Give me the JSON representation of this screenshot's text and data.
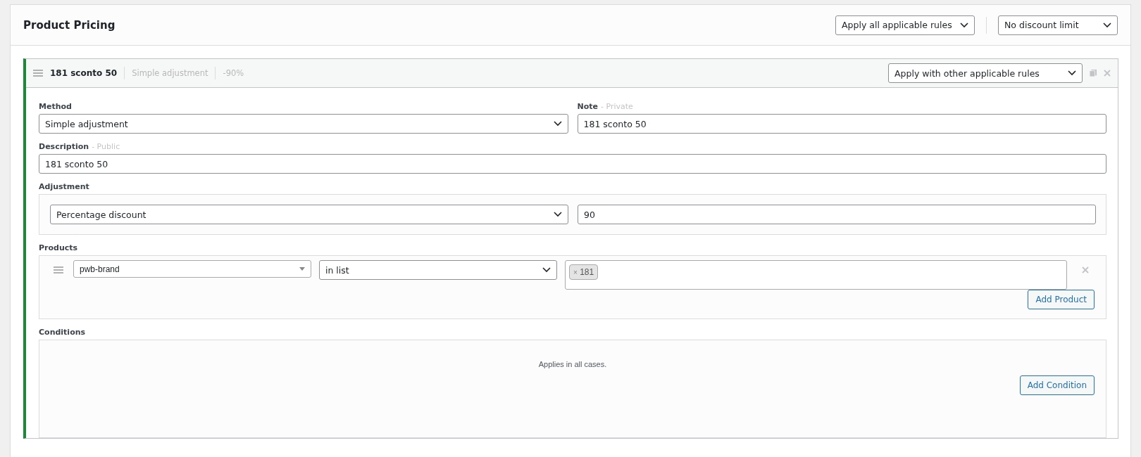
{
  "panel": {
    "title": "Product Pricing",
    "apply_mode": "Apply all applicable rules",
    "discount_limit": "No discount limit"
  },
  "rule": {
    "title": "181 sconto 50",
    "method_summary": "Simple adjustment",
    "amount_summary": "-90%",
    "exclusivity": "Apply with other applicable rules",
    "method": {
      "label": "Method",
      "value": "Simple adjustment"
    },
    "note": {
      "label": "Note",
      "hint": "- Private",
      "value": "181 sconto 50"
    },
    "description": {
      "label": "Description",
      "hint": "- Public",
      "value": "181 sconto 50"
    },
    "adjustment": {
      "label": "Adjustment",
      "type": "Percentage discount",
      "value": "90"
    },
    "products": {
      "label": "Products",
      "rows": [
        {
          "property": "pwb-brand",
          "operator": "in list",
          "tags": [
            {
              "remove": "×",
              "label": "181"
            }
          ]
        }
      ],
      "add_button": "Add Product"
    },
    "conditions": {
      "label": "Conditions",
      "empty_text": "Applies in all cases.",
      "add_button": "Add Condition"
    }
  }
}
